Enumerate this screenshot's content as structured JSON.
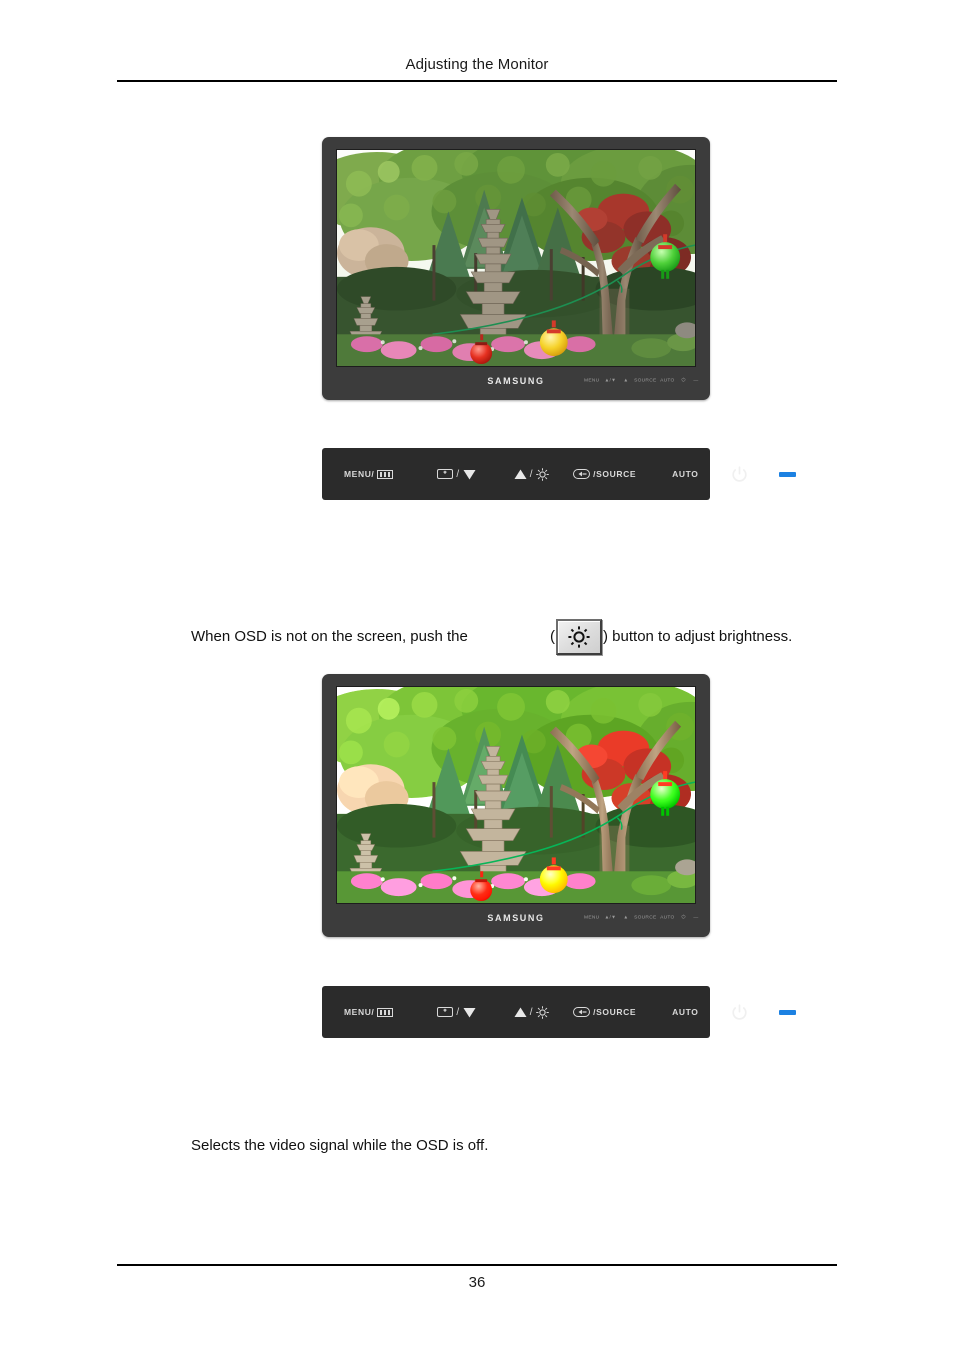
{
  "document": {
    "header_title": "Adjusting the Monitor",
    "page_number": "36"
  },
  "sections": [
    {
      "id": "brightness",
      "figure": {
        "device": "samsung-monitor",
        "brand_label": "SAMSUNG",
        "screen_content": "garden scene with stone pagoda, trees and hanging lanterns",
        "bezel_keys": [
          "MENU",
          "▼",
          "▲",
          "SOURCE",
          "AUTO",
          "⏻",
          "LED"
        ]
      },
      "control_panel": {
        "buttons": [
          {
            "name": "menu",
            "label": "MENU/",
            "icon": "menu-bars-icon"
          },
          {
            "name": "down",
            "label": "",
            "icon": "plus-box-icon",
            "slash": "/",
            "icon2": "triangle-down-icon"
          },
          {
            "name": "up",
            "label": "",
            "icon": "triangle-up-icon",
            "slash": "/",
            "icon2": "brightness-sun-icon"
          },
          {
            "name": "source",
            "label": "/SOURCE",
            "icon": "source-icon"
          },
          {
            "name": "auto",
            "label": "AUTO",
            "icon": ""
          },
          {
            "name": "power",
            "label": "",
            "icon": "power-icon"
          },
          {
            "name": "led",
            "label": "",
            "icon": "led-indicator"
          }
        ],
        "led_color": "#1c81e2",
        "panel_color": "#2b2b2b"
      },
      "caption_before": "When OSD is not on the screen, push the",
      "caption_paren_open": "(",
      "caption_key_icon": "brightness-sun-icon",
      "caption_paren_close": ")",
      "caption_after": "button to adjust brightness."
    },
    {
      "id": "source",
      "figure": {
        "device": "samsung-monitor",
        "brand_label": "SAMSUNG",
        "screen_content": "garden scene with stone pagoda, trees and hanging lanterns (brighter)",
        "bezel_keys": [
          "MENU",
          "▼",
          "▲",
          "SOURCE",
          "AUTO",
          "⏻",
          "LED"
        ]
      },
      "control_panel": {
        "buttons": [
          {
            "name": "menu",
            "label": "MENU/",
            "icon": "menu-bars-icon"
          },
          {
            "name": "down",
            "label": "",
            "icon": "plus-box-icon",
            "slash": "/",
            "icon2": "triangle-down-icon"
          },
          {
            "name": "up",
            "label": "",
            "icon": "triangle-up-icon",
            "slash": "/",
            "icon2": "brightness-sun-icon"
          },
          {
            "name": "source",
            "label": "/SOURCE",
            "icon": "source-icon"
          },
          {
            "name": "auto",
            "label": "AUTO",
            "icon": ""
          },
          {
            "name": "power",
            "label": "",
            "icon": "power-icon"
          },
          {
            "name": "led",
            "label": "",
            "icon": "led-indicator"
          }
        ],
        "led_color": "#1c81e2",
        "panel_color": "#2b2b2b"
      },
      "caption": "Selects the video signal while the OSD is off."
    }
  ],
  "labels": {
    "menu": "MENU/",
    "source": "/SOURCE",
    "auto": "AUTO",
    "samsung": "SAMSUNG",
    "slash": "/"
  },
  "bezel_micro_labels": {
    "k1": "MENU",
    "k2": "▲/▼",
    "k3": "▲",
    "k4": "SOURCE",
    "k5": "AUTO",
    "k6": "⏻",
    "k7": "—"
  },
  "colors": {
    "bezel": "#3c3c3c",
    "panel": "#2b2b2b",
    "led": "#1c81e2",
    "text": "#111111",
    "panel_text": "#d9d9d9"
  }
}
